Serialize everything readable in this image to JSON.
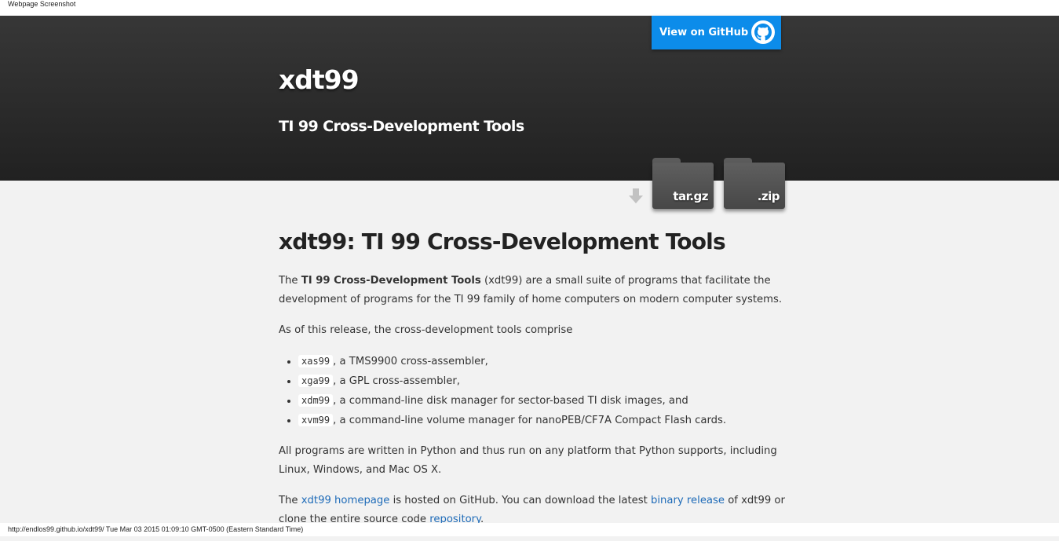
{
  "caption": "Webpage Screenshot",
  "header": {
    "github_button_label": "View on GitHub",
    "title": "xdt99",
    "tagline": "TI 99 Cross-Development Tools"
  },
  "downloads": {
    "tar_label": "tar.gz",
    "zip_label": ".zip"
  },
  "main": {
    "heading": "xdt99: TI 99 Cross-Development Tools",
    "intro": {
      "pre": "The ",
      "bold": "TI 99 Cross-Development Tools",
      "post": " (xdt99) are a small suite of programs that facilitate the development of programs for the TI 99 family of home computers on modern computer systems."
    },
    "release_text": "As of this release, the cross-development tools comprise",
    "tools": [
      {
        "code": "xas99",
        "desc": ", a TMS9900 cross-assembler,"
      },
      {
        "code": "xga99",
        "desc": ", a GPL cross-assembler,"
      },
      {
        "code": "xdm99",
        "desc": ", a command-line disk manager for sector-based TI disk images, and"
      },
      {
        "code": "xvm99",
        "desc": ", a command-line volume manager for nanoPEB/CF7A Compact Flash cards."
      }
    ],
    "python_text": "All programs are written in Python and thus run on any platform that Python supports, including Linux, Windows, and Mac OS X.",
    "hosting": {
      "t1": "The ",
      "link1": "xdt99 homepage",
      "t2": " is hosted on GitHub. You can download the latest ",
      "link2": "binary release",
      "t3": " of xdt99 or clone the entire source code ",
      "link3": "repository",
      "t4": "."
    }
  },
  "status_bar": "http://endlos99.github.io/xdt99/ Tue Mar 03 2015 01:09:10 GMT-0500 (Eastern Standard Time)"
}
